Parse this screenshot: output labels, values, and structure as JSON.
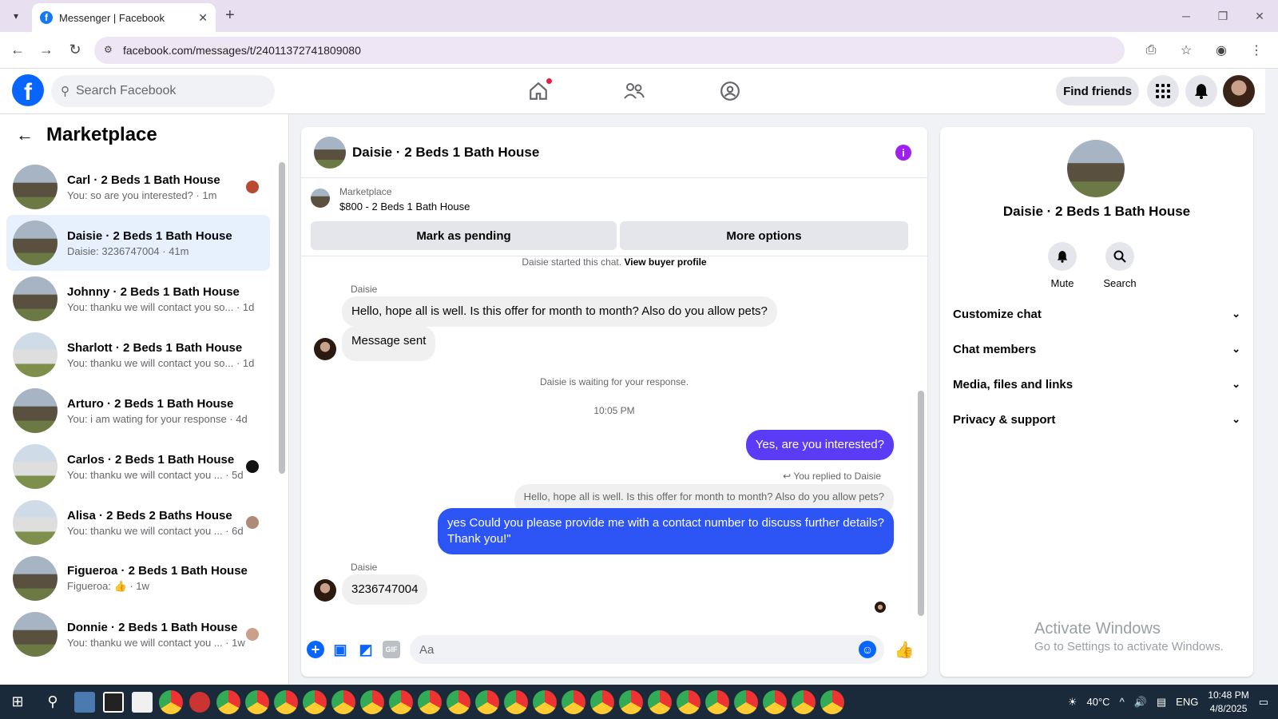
{
  "browser": {
    "tab_title": "Messenger | Facebook",
    "url": "facebook.com/messages/t/24011372741809080"
  },
  "fb": {
    "search_placeholder": "Search Facebook",
    "find_friends": "Find friends"
  },
  "sidebar": {
    "title": "Marketplace",
    "conversations": [
      {
        "name": "Carl · 2 Beds 1 Bath House",
        "snippet": "You: so are you interested? · 1m"
      },
      {
        "name": "Daisie · 2 Beds 1 Bath House",
        "snippet": "Daisie: 3236747004 · 41m"
      },
      {
        "name": "Johnny · 2 Beds 1 Bath House",
        "snippet": "You: thanku we will contact you so... · 1d"
      },
      {
        "name": "Sharlott · 2 Beds 1 Bath House",
        "snippet": "You: thanku we will contact you so... · 1d"
      },
      {
        "name": "Arturo · 2 Beds 1 Bath House",
        "snippet": "You: i am wating for your response · 4d"
      },
      {
        "name": "Carlos · 2 Beds 1 Bath House",
        "snippet": "You: thanku we will contact you ... · 5d"
      },
      {
        "name": "Alisa · 2 Beds 2 Baths House",
        "snippet": "You: thanku we will contact you ... · 6d"
      },
      {
        "name": "Figueroa · 2 Beds 1 Bath House",
        "snippet": "Figueroa: 👍 · 1w"
      },
      {
        "name": "Donnie · 2 Beds 1 Bath House",
        "snippet": "You: thanku we will contact you ... · 1w"
      }
    ]
  },
  "chat": {
    "title": "Daisie · 2 Beds 1 Bath House",
    "marketplace_label": "Marketplace",
    "listing": "$800 - 2 Beds 1 Bath House",
    "mark_pending": "Mark as pending",
    "more_options": "More options",
    "started_text": "Daisie started this chat.",
    "view_profile": "View buyer profile",
    "sender_name": "Daisie",
    "msg1": "Hello, hope all is well. Is this offer for month to month? Also do you allow pets?",
    "msg2": "Message sent",
    "waiting": "Daisie is waiting for your response.",
    "time": "10:05 PM",
    "out1": "Yes, are you interested?",
    "replied_to": "You replied to Daisie",
    "quote": "Hello, hope all is well. Is this offer for month to month? Also do you allow pets?",
    "out2_line1": "yes Could you please provide me with a contact number to discuss further details?",
    "out2_line2": "Thank you!\"",
    "sender_name2": "Daisie",
    "msg3": "3236747004",
    "composer_placeholder": "Aa"
  },
  "details": {
    "name": "Daisie · 2 Beds 1 Bath House",
    "mute": "Mute",
    "search": "Search",
    "sections": [
      "Customize chat",
      "Chat members",
      "Media, files and links",
      "Privacy & support"
    ]
  },
  "watermark": {
    "line1": "Activate Windows",
    "line2": "Go to Settings to activate Windows."
  },
  "taskbar": {
    "weather": "40°C",
    "lang": "ENG",
    "time": "10:48 PM",
    "date": "4/8/2025"
  }
}
